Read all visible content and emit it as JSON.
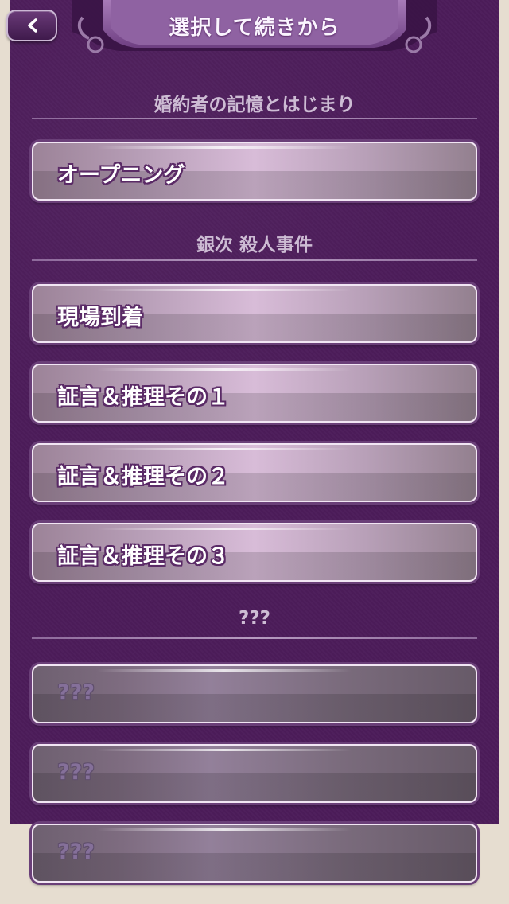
{
  "header": {
    "title": "選択して続きから",
    "back_icon": "chevron-left-icon"
  },
  "sections": [
    {
      "title": "婚約者の記憶とはじまり",
      "items": [
        {
          "label": "オープニング",
          "locked": false
        }
      ]
    },
    {
      "title": "銀次 殺人事件",
      "items": [
        {
          "label": "現場到着",
          "locked": false
        },
        {
          "label": "証言＆推理その１",
          "locked": false
        },
        {
          "label": "証言＆推理その２",
          "locked": false
        },
        {
          "label": "証言＆推理その３",
          "locked": false
        }
      ]
    },
    {
      "title": "???",
      "items": [
        {
          "label": "???",
          "locked": true
        },
        {
          "label": "???",
          "locked": true
        },
        {
          "label": "???",
          "locked": true
        }
      ]
    }
  ],
  "colors": {
    "panel": "#4c1c5a",
    "background": "#e6ddd0",
    "accent": "#9b6bb0"
  }
}
